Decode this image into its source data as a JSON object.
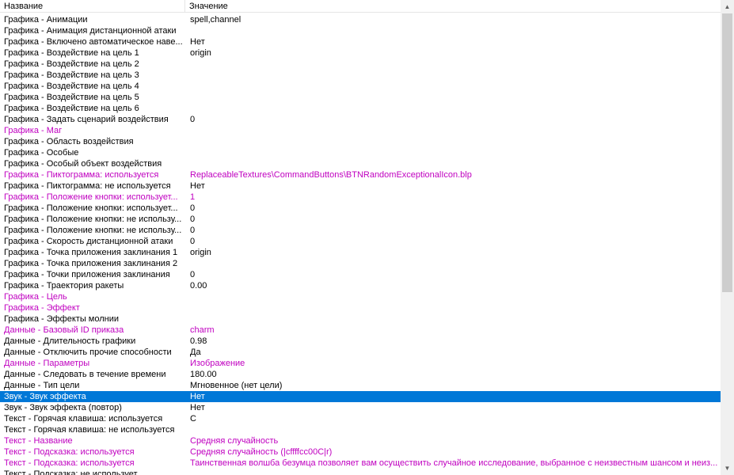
{
  "header": {
    "name": "Название",
    "value": "Значение"
  },
  "colors": {
    "modified": "#c000c0",
    "selected": "#0078d7"
  },
  "rows": [
    {
      "name": "Графика - Анимации",
      "value": "spell,channel",
      "state": "normal"
    },
    {
      "name": "Графика - Анимация дистанционной атаки",
      "value": "",
      "state": "normal"
    },
    {
      "name": "Графика - Включено автоматическое наве...",
      "value": "Нет",
      "state": "normal"
    },
    {
      "name": "Графика - Воздействие на цель 1",
      "value": "origin",
      "state": "normal"
    },
    {
      "name": "Графика - Воздействие на цель 2",
      "value": "",
      "state": "normal"
    },
    {
      "name": "Графика - Воздействие на цель 3",
      "value": "",
      "state": "normal"
    },
    {
      "name": "Графика - Воздействие на цель 4",
      "value": "",
      "state": "normal"
    },
    {
      "name": "Графика - Воздействие на цель 5",
      "value": "",
      "state": "normal"
    },
    {
      "name": "Графика - Воздействие на цель 6",
      "value": "",
      "state": "normal"
    },
    {
      "name": "Графика - Задать сценарий воздействия",
      "value": "0",
      "state": "normal"
    },
    {
      "name": "Графика - Маг",
      "value": "",
      "state": "modified"
    },
    {
      "name": "Графика - Область воздействия",
      "value": "",
      "state": "normal"
    },
    {
      "name": "Графика - Особые",
      "value": "",
      "state": "normal"
    },
    {
      "name": "Графика - Особый объект воздействия",
      "value": "",
      "state": "normal"
    },
    {
      "name": "Графика - Пиктограмма: используется",
      "value": "ReplaceableTextures\\CommandButtons\\BTNRandomExceptionalIcon.blp",
      "state": "modified"
    },
    {
      "name": "Графика - Пиктограмма: не используется",
      "value": "Нет",
      "state": "normal"
    },
    {
      "name": "Графика - Положение кнопки: использует...",
      "value": "1",
      "state": "modified"
    },
    {
      "name": "Графика - Положение кнопки: использует...",
      "value": "0",
      "state": "normal"
    },
    {
      "name": "Графика - Положение кнопки: не использу...",
      "value": "0",
      "state": "normal"
    },
    {
      "name": "Графика - Положение кнопки: не использу...",
      "value": "0",
      "state": "normal"
    },
    {
      "name": "Графика - Скорость дистанционной атаки",
      "value": "0",
      "state": "normal"
    },
    {
      "name": "Графика - Точка приложения заклинания 1",
      "value": "origin",
      "state": "normal"
    },
    {
      "name": "Графика - Точка приложения заклинания 2",
      "value": "",
      "state": "normal"
    },
    {
      "name": "Графика - Точки приложения заклинания",
      "value": "0",
      "state": "normal"
    },
    {
      "name": "Графика - Траектория ракеты",
      "value": "0.00",
      "state": "normal"
    },
    {
      "name": "Графика - Цель",
      "value": "",
      "state": "modified"
    },
    {
      "name": "Графика - Эффект",
      "value": "",
      "state": "modified"
    },
    {
      "name": "Графика - Эффекты молнии",
      "value": "",
      "state": "normal"
    },
    {
      "name": "Данные - Базовый ID приказа",
      "value": "charm",
      "state": "modified"
    },
    {
      "name": "Данные - Длительность графики",
      "value": "0.98",
      "state": "normal"
    },
    {
      "name": "Данные - Отключить прочие способности",
      "value": "Да",
      "state": "normal"
    },
    {
      "name": "Данные - Параметры",
      "value": "Изображение",
      "state": "modified"
    },
    {
      "name": "Данные - Следовать в течение времени",
      "value": "180.00",
      "state": "normal"
    },
    {
      "name": "Данные - Тип цели",
      "value": "Мгновенное (нет цели)",
      "state": "normal"
    },
    {
      "name": "Звук - Звук эффекта",
      "value": "Нет",
      "state": "selected"
    },
    {
      "name": "Звук - Звук эффекта (повтор)",
      "value": "Нет",
      "state": "normal"
    },
    {
      "name": "Текст - Горячая клавиша: используется",
      "value": "C",
      "state": "normal"
    },
    {
      "name": "Текст - Горячая клавиша: не используется",
      "value": "",
      "state": "normal"
    },
    {
      "name": "Текст - Название",
      "value": "Средняя случайность",
      "state": "modified"
    },
    {
      "name": "Текст - Подсказка: используется",
      "value": "Средняя случайность (|cffffcc00C|r)",
      "state": "modified"
    },
    {
      "name": "Текст - Подсказка: используется",
      "value": "Таинственная волшба безумца позволяет вам осуществить случайное исследование, выбранное с неизвестным шансом и неиз...",
      "state": "modified"
    },
    {
      "name": "Текст - Подсказка: не использует...",
      "value": "",
      "state": "normal"
    }
  ]
}
